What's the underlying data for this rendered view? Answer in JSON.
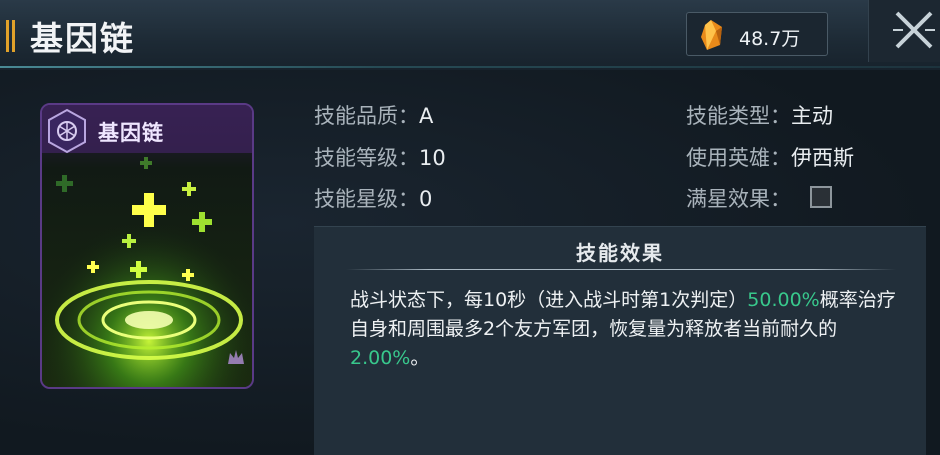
{
  "header": {
    "title": "基因链",
    "currency": {
      "icon": "orange-crystal-icon",
      "value": "48.7万"
    },
    "close_icon": "close-icon"
  },
  "card": {
    "name": "基因链",
    "rarity_icon": "hexagon-emblem-icon",
    "corner_icon": "crown-mark-icon"
  },
  "info": {
    "quality": {
      "label": "技能品质：",
      "value": "A"
    },
    "level": {
      "label": "技能等级：",
      "value": "10"
    },
    "star": {
      "label": "技能星级：",
      "value": "0"
    },
    "type": {
      "label": "技能类型：",
      "value": "主动"
    },
    "hero": {
      "label": "使用英雄：",
      "value": "伊西斯"
    },
    "max_star": {
      "label": "满星效果：",
      "checked": false
    }
  },
  "effect": {
    "title": "技能效果",
    "text_1": "战斗状态下，每10秒（进入战斗时第1次判定）",
    "pct_1": "50.00%",
    "text_2": "概率治疗自身和周围最多2个友方军团，恢复量为释放者当前耐久的",
    "pct_2": "2.00%",
    "text_3": "。"
  },
  "colors": {
    "accent": "#e0a12a",
    "highlight": "#38c88c",
    "card_purple": "#5a3a86"
  }
}
